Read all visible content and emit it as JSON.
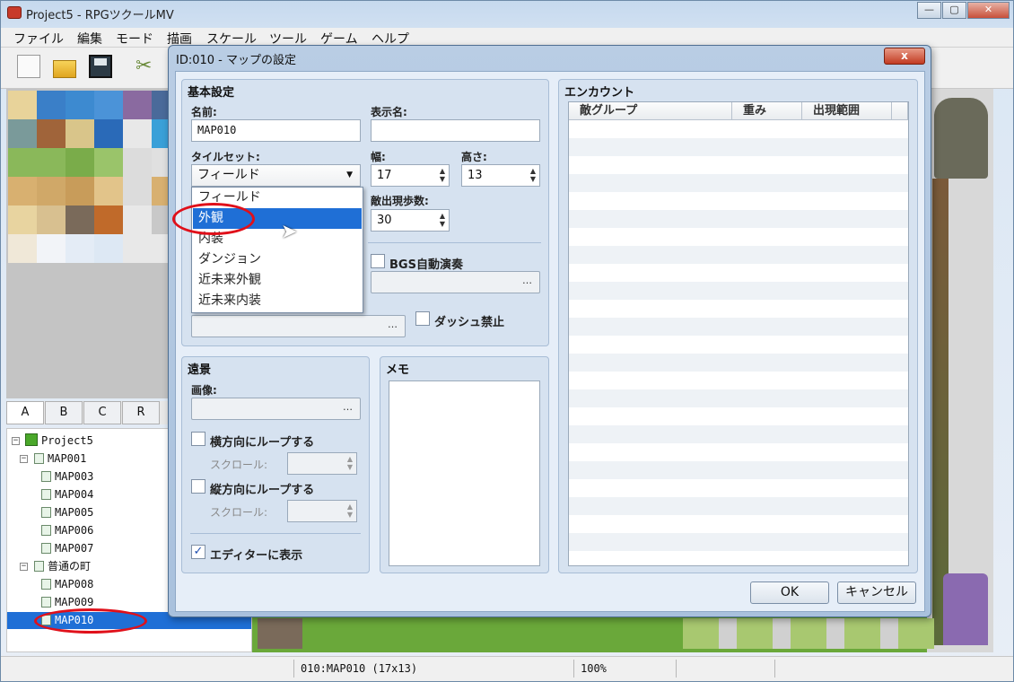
{
  "window": {
    "title": "Project5 - RPGツクールMV",
    "minimize": "—",
    "maximize": "▢",
    "close": "✕"
  },
  "menu": [
    "ファイル",
    "編集",
    "モード",
    "描画",
    "スケール",
    "ツール",
    "ゲーム",
    "ヘルプ"
  ],
  "toolbar": {
    "icons": [
      "new-project-icon",
      "open-folder-icon",
      "save-icon",
      "cut-icon"
    ]
  },
  "tabs": [
    "A",
    "B",
    "C",
    "R"
  ],
  "tree": {
    "root": "Project5",
    "map001": "MAP001",
    "children1": [
      "MAP003",
      "MAP004",
      "MAP005",
      "MAP006",
      "MAP007"
    ],
    "town": "普通の町",
    "children2": [
      "MAP008",
      "MAP009",
      "MAP010"
    ],
    "selected": "MAP010"
  },
  "statusbar": {
    "map": "010:MAP010 (17x13)",
    "zoom": "100%"
  },
  "dialog": {
    "title": "ID:010 - マップの設定",
    "close": "x",
    "basic": {
      "title": "基本設定",
      "name_label": "名前:",
      "name_value": "MAP010",
      "display_label": "表示名:",
      "display_value": "",
      "tileset_label": "タイルセット:",
      "tileset_value": "フィールド",
      "width_label": "幅:",
      "width_value": "17",
      "height_label": "高さ:",
      "height_value": "13",
      "encounter_steps_label": "敵出現歩数:",
      "encounter_steps_value": "30",
      "bgs_label": "BGS自動演奏",
      "dash_label": "ダッシュ禁止",
      "ellipsis": "…"
    },
    "tileset_options": [
      "フィールド",
      "外観",
      "内装",
      "ダンジョン",
      "近未来外観",
      "近未来内装"
    ],
    "tileset_highlighted": "外観",
    "parallax": {
      "title": "遠景",
      "image_label": "画像:",
      "loop_h_label": "横方向にループする",
      "loop_v_label": "縦方向にループする",
      "scroll_label": "スクロール:",
      "show_editor_label": "エディターに表示",
      "show_editor_checked": "✓"
    },
    "memo": {
      "title": "メモ"
    },
    "encounter": {
      "title": "エンカウント",
      "columns": [
        "敵グループ",
        "重み",
        "出現範囲"
      ]
    },
    "ok": "OK",
    "cancel": "キャンセル"
  }
}
